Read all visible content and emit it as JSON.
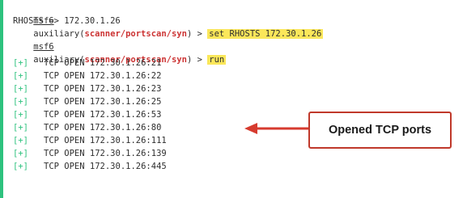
{
  "prompt": {
    "user": "msf6",
    "context_prefix": "auxiliary(",
    "module": "scanner/portscan/syn",
    "context_suffix": ")",
    "symbol": " > "
  },
  "commands": [
    {
      "text": "set RHOSTS 172.30.1.26"
    },
    {
      "text": "run"
    }
  ],
  "set_output": "RHOSTS => 172.30.1.26",
  "results": {
    "marker": "[+]",
    "items": [
      "TCP OPEN 172.30.1.26:21",
      "TCP OPEN 172.30.1.26:22",
      "TCP OPEN 172.30.1.26:23",
      "TCP OPEN 172.30.1.26:25",
      "TCP OPEN 172.30.1.26:53",
      "TCP OPEN 172.30.1.26:80",
      "TCP OPEN 172.30.1.26:111",
      "TCP OPEN 172.30.1.26:139",
      "TCP OPEN 172.30.1.26:445"
    ]
  },
  "annotation": {
    "label": "Opened TCP ports",
    "border_color": "#c0392b",
    "arrow_color": "#d63b2f"
  },
  "colors": {
    "accent_green": "#2ec27e",
    "highlight_yellow": "#fbe75a",
    "module_red": "#cc3333"
  }
}
